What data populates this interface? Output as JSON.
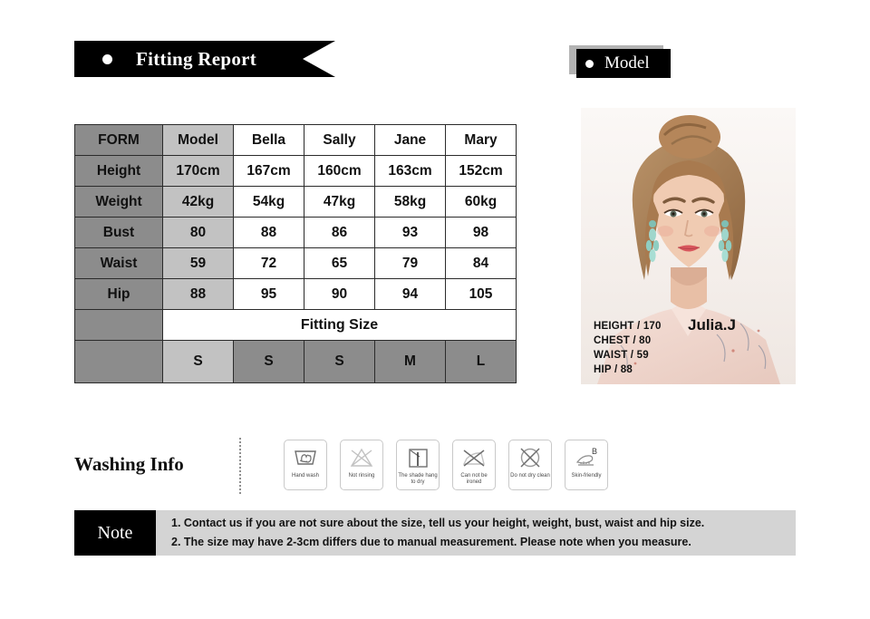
{
  "header": {
    "fitting_report_title": "Fitting Report",
    "model_badge_title": "Model"
  },
  "size_table": {
    "columns": [
      "FORM",
      "Model",
      "Bella",
      "Sally",
      "Jane",
      "Mary"
    ],
    "rows": [
      {
        "label": "Height",
        "values": [
          "170cm",
          "167cm",
          "160cm",
          "163cm",
          "152cm"
        ]
      },
      {
        "label": "Weight",
        "values": [
          "42kg",
          "54kg",
          "47kg",
          "58kg",
          "60kg"
        ]
      },
      {
        "label": "Bust",
        "values": [
          "80",
          "88",
          "86",
          "93",
          "98"
        ]
      },
      {
        "label": "Waist",
        "values": [
          "59",
          "72",
          "65",
          "79",
          "84"
        ]
      },
      {
        "label": "Hip",
        "values": [
          "88",
          "95",
          "90",
          "94",
          "105"
        ]
      }
    ],
    "fitting_size_label": "Fitting Size",
    "fitting_sizes": [
      "S",
      "S",
      "S",
      "M",
      "L"
    ]
  },
  "model_photo": {
    "name": "Julia.J",
    "stats": [
      "HEIGHT /  170",
      "CHEST /  80",
      "WAIST /  59",
      "HIP /  88"
    ]
  },
  "washing": {
    "title": "Washing Info",
    "icons": [
      {
        "name": "hand-wash-icon",
        "label": "Hand wash"
      },
      {
        "name": "not-rinsing-icon",
        "label": "Not rinsing"
      },
      {
        "name": "shade-hang-dry-icon",
        "label": "The shade hang to dry"
      },
      {
        "name": "do-not-iron-icon",
        "label": "Can not be ironed"
      },
      {
        "name": "do-not-dry-clean-icon",
        "label": "Do not dry clean"
      },
      {
        "name": "skin-friendly-icon",
        "label": "Skin-friendly"
      }
    ]
  },
  "note": {
    "badge": "Note",
    "lines": [
      "1. Contact us if you are not sure about the size, tell us your height, weight, bust, waist and hip size.",
      "2. The size may have 2-3cm differs due to manual measurement. Please note when you measure."
    ]
  },
  "colors": {
    "black": "#000000",
    "header_grey": "#8c8c8c",
    "model_col_grey": "#c2c2c2",
    "note_band_grey": "#d4d4d4"
  }
}
